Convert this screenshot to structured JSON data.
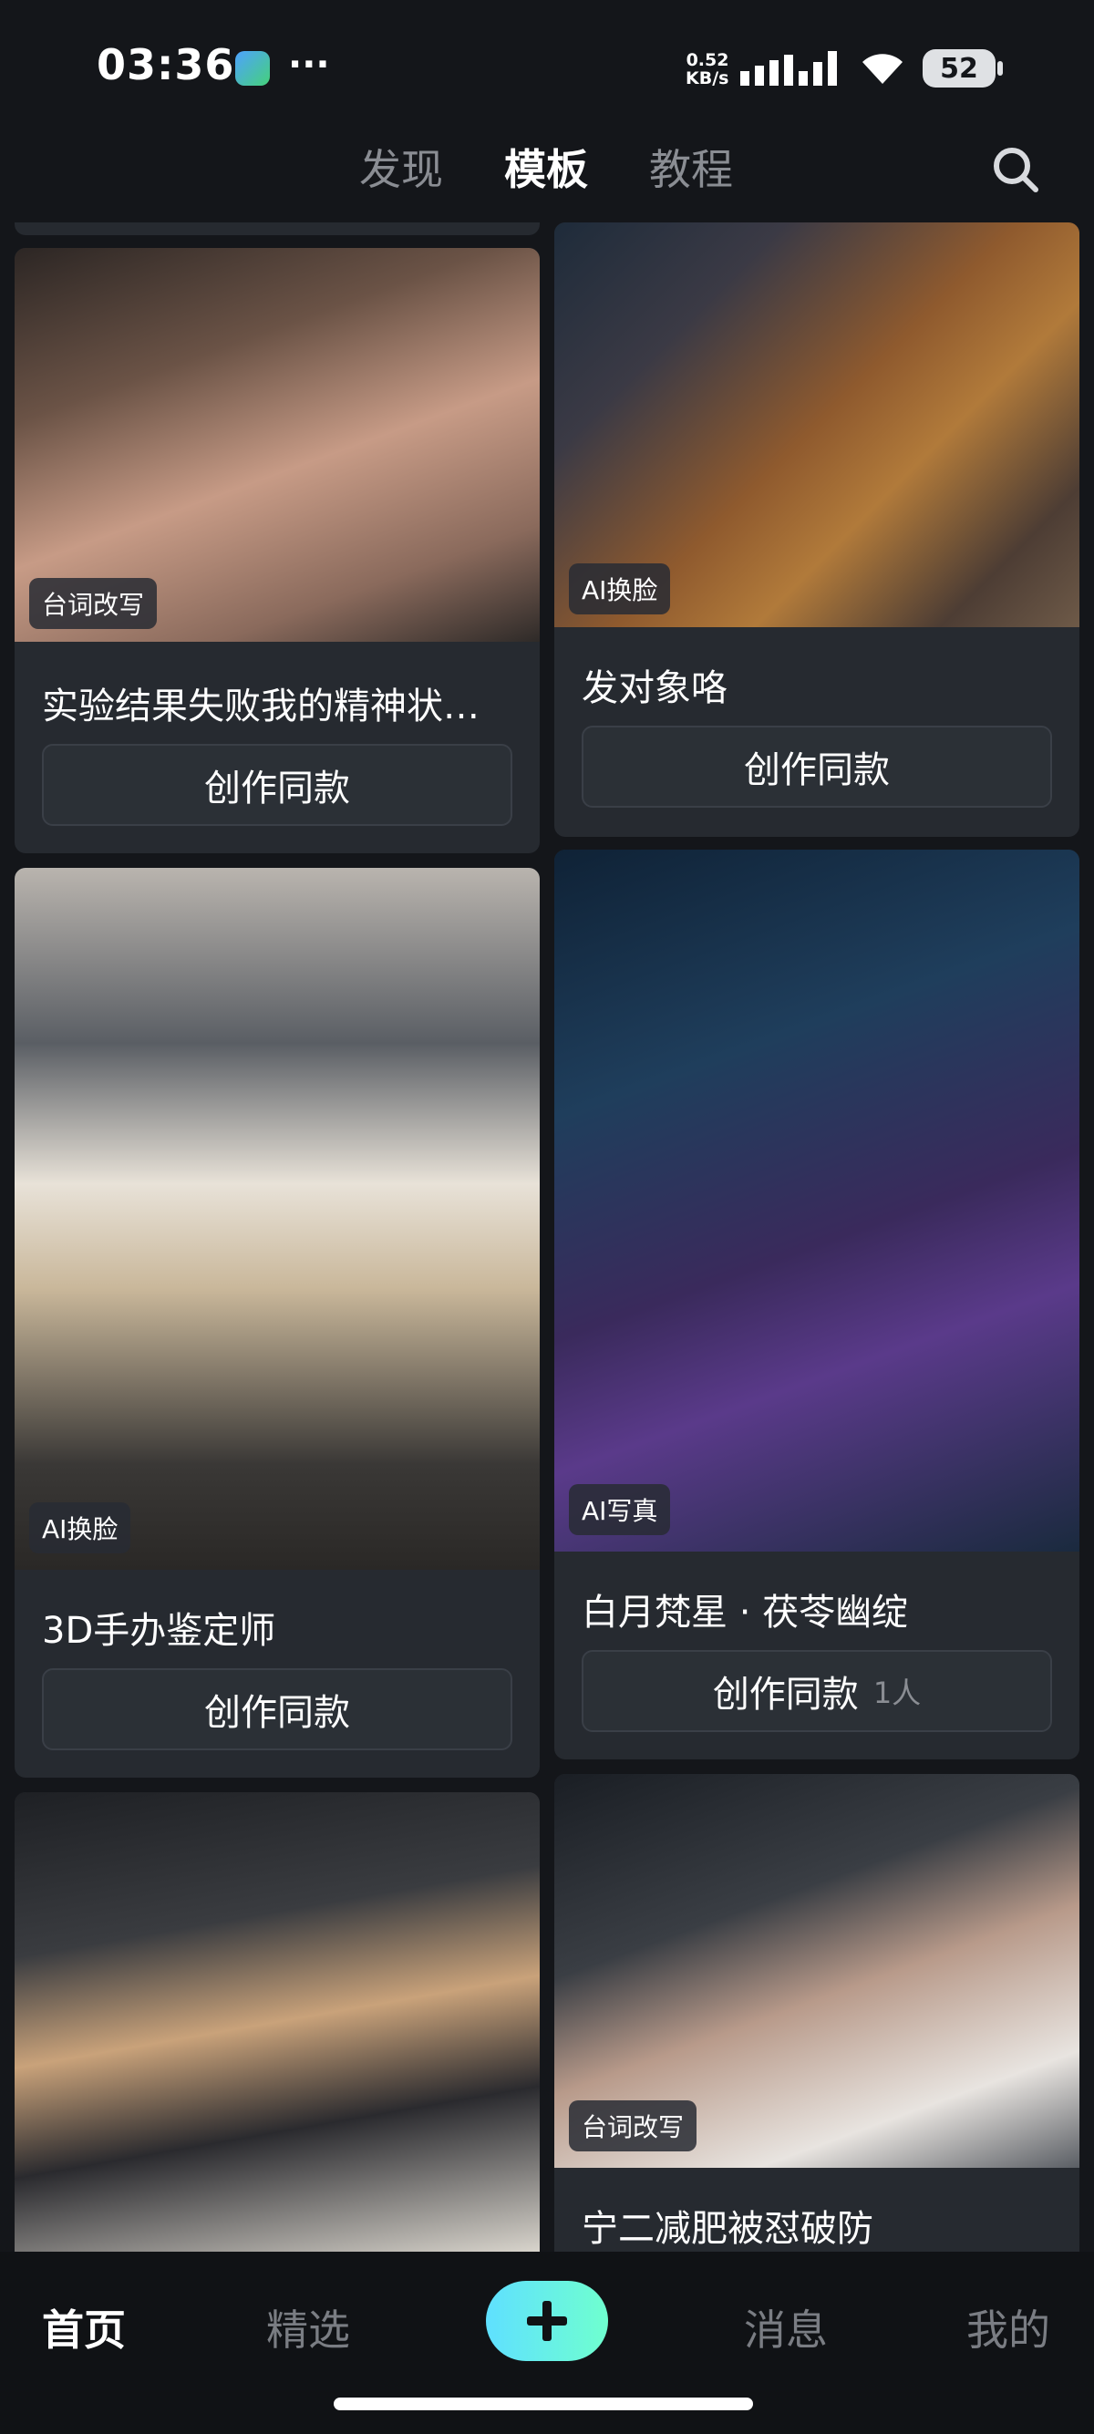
{
  "status": {
    "time": "03:36",
    "more": "···",
    "net_speed_value": "0.52",
    "net_speed_unit": "KB/s",
    "battery": "52"
  },
  "top_tabs": [
    {
      "label": "发现",
      "active": false
    },
    {
      "label": "模板",
      "active": true
    },
    {
      "label": "教程",
      "active": false
    }
  ],
  "cards": [
    {
      "tag": "台词改写",
      "title": "实验结果失败我的精神状…",
      "button": "创作同款",
      "count": ""
    },
    {
      "tag": "AI换脸",
      "title": "发对象咯",
      "button": "创作同款",
      "count": ""
    },
    {
      "tag": "AI换脸",
      "title": "3D手办鉴定师",
      "button": "创作同款",
      "count": ""
    },
    {
      "tag": "AI写真",
      "title": "白月梵星 · 茯苓幽绽",
      "button": "创作同款",
      "count": "1人"
    },
    {
      "tag": "",
      "title": "",
      "button": "",
      "count": ""
    },
    {
      "tag": "台词改写",
      "title": "宁二减肥被怼破防",
      "button": "",
      "count": ""
    }
  ],
  "bottom_nav": [
    {
      "label": "首页",
      "active": true
    },
    {
      "label": "精选",
      "active": false
    },
    {
      "label": "消息",
      "active": false
    },
    {
      "label": "我的",
      "active": false
    }
  ],
  "icons": {
    "search": "search-icon",
    "add": "plus-icon",
    "signal": "signal-icon",
    "wifi": "wifi-icon",
    "app": "gallery-app-icon"
  },
  "colors": {
    "background": "#14161a",
    "card": "#262a30",
    "accent_gradient_start": "#5fe0ff",
    "accent_gradient_end": "#6fffcf"
  }
}
